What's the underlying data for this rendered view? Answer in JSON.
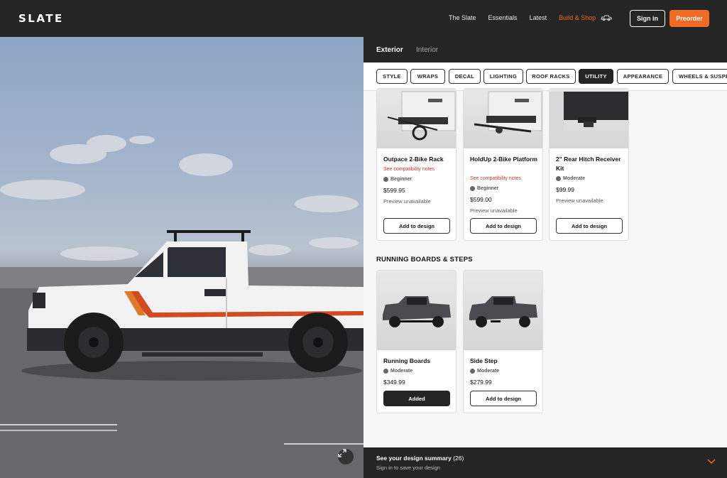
{
  "nav": {
    "logo": "SLATE",
    "links": [
      "The Slate",
      "Essentials",
      "Latest",
      "Build & Shop"
    ],
    "signin": "Sign in",
    "preorder": "Preorder",
    "accent_color": "#f26b24"
  },
  "panel": {
    "tabs": [
      "Exterior",
      "Interior"
    ],
    "filters": [
      "STYLE",
      "WRAPS",
      "DECAL",
      "LIGHTING",
      "ROOF RACKS",
      "UTILITY",
      "APPEARANCE",
      "WHEELS & SUSPE"
    ],
    "active_filter": "UTILITY"
  },
  "bike_cards": [
    {
      "title": "Outpace 2-Bike Rack",
      "compat": "See compatibility notes",
      "level": "Beginner",
      "price": "$599.95",
      "preview": "Preview unavailable",
      "button": "Add to design"
    },
    {
      "title": "HoldUp 2-Bike Platform",
      "compat": "See compatibility notes",
      "level": "Beginner",
      "price": "$599.00",
      "preview": "Preview unavailable",
      "button": "Add to design"
    },
    {
      "title": "2\" Rear Hitch Receiver Kit",
      "level": "Moderate",
      "price": "$99.99",
      "preview": "Preview unavailable",
      "button": "Add to design"
    }
  ],
  "running_section": "RUNNING BOARDS & STEPS",
  "running_cards": [
    {
      "title": "Running Boards",
      "level": "Moderate",
      "price": "$349.99",
      "button": "Added"
    },
    {
      "title": "Side Step",
      "level": "Moderate",
      "price": "$279.99",
      "button": "Add to design"
    }
  ],
  "summary": {
    "title": "See your design summary",
    "count": "(26)",
    "subtitle": "Sign in to save your design"
  }
}
